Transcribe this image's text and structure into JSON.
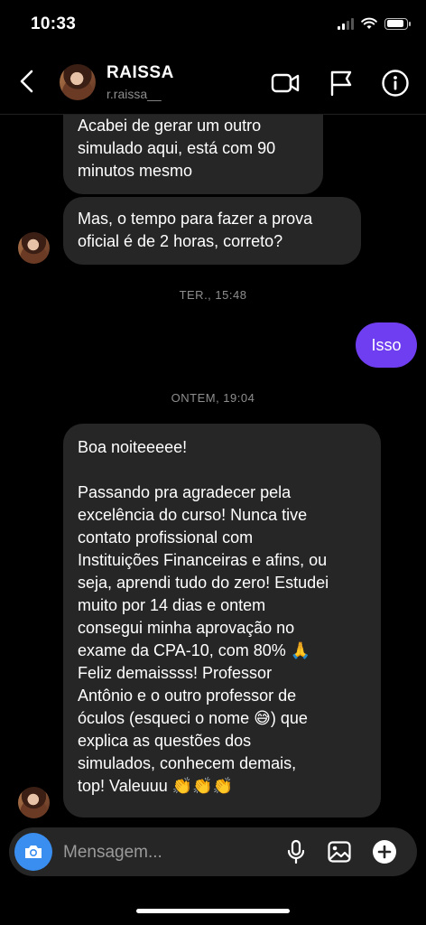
{
  "status_bar": {
    "time": "10:33"
  },
  "header": {
    "contact_name": "RAISSA",
    "username": "r.raissa__",
    "icons": [
      "back-icon",
      "video-call-icon",
      "flag-icon",
      "info-icon"
    ]
  },
  "messages": [
    {
      "from": "contact",
      "text": "Acabei de gerar um outro\nsimulado aqui, está com 90\nminutos mesmo"
    },
    {
      "from": "contact",
      "text": "Mas, o tempo para fazer a prova\noficial é de 2 horas, correto?"
    },
    {
      "from": "timestamp",
      "text": "TER., 15:48"
    },
    {
      "from": "me",
      "text": "Isso"
    },
    {
      "from": "timestamp",
      "text": "ONTEM, 19:04"
    },
    {
      "from": "contact",
      "text": "Boa noiteeeee!\n\nPassando pra agradecer pela\nexcelência do curso! Nunca tive\ncontato profissional com\nInstituições Financeiras e afins, ou\nseja, aprendi tudo do zero! Estudei\nmuito por 14 dias e ontem\nconsegui minha aprovação no\nexame da CPA-10, com 80% 🙏\nFeliz demaissss! Professor\nAntônio e o outro professor de\nóculos (esqueci o nome 😅) que\nexplica as questões dos\nsimulados, conhecem demais,\ntop! Valeuuu 👏👏👏"
    }
  ],
  "composer": {
    "placeholder": "Mensagem...",
    "icons": [
      "camera-icon",
      "microphone-icon",
      "gallery-icon",
      "add-icon"
    ]
  },
  "colors": {
    "sent_bubble": "#6f3ef0",
    "received_bubble": "#262626",
    "camera_button": "#3a8ef0"
  }
}
